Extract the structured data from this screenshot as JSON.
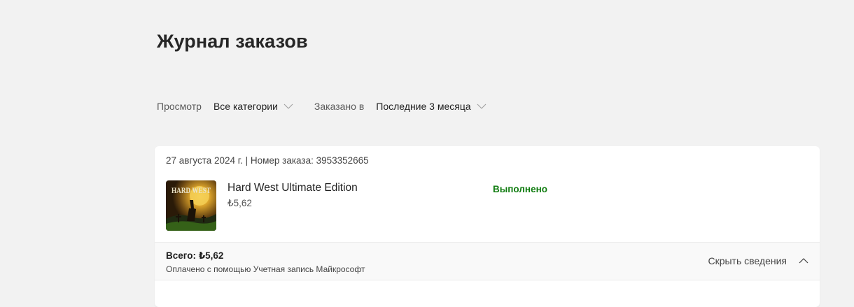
{
  "page": {
    "title": "Журнал заказов"
  },
  "filters": {
    "view_label": "Просмотр",
    "view_value": "Все категории",
    "ordered_label": "Заказано в",
    "ordered_value": "Последние 3 месяца"
  },
  "order": {
    "meta": "27 августа 2024 г. | Номер заказа: 3953352665",
    "item": {
      "title": "Hard West Ultimate Edition",
      "price": "₺5,62",
      "status": "Выполнено",
      "thumb_text": "HARD WEST"
    },
    "summary": {
      "total": "Всего: ₺5,62",
      "paid_with": "Оплачено с помощью Учетная запись Майкрософт",
      "toggle_label": "Скрыть сведения"
    }
  },
  "colors": {
    "background": "#f2f2f2",
    "status_green": "#107c10"
  }
}
